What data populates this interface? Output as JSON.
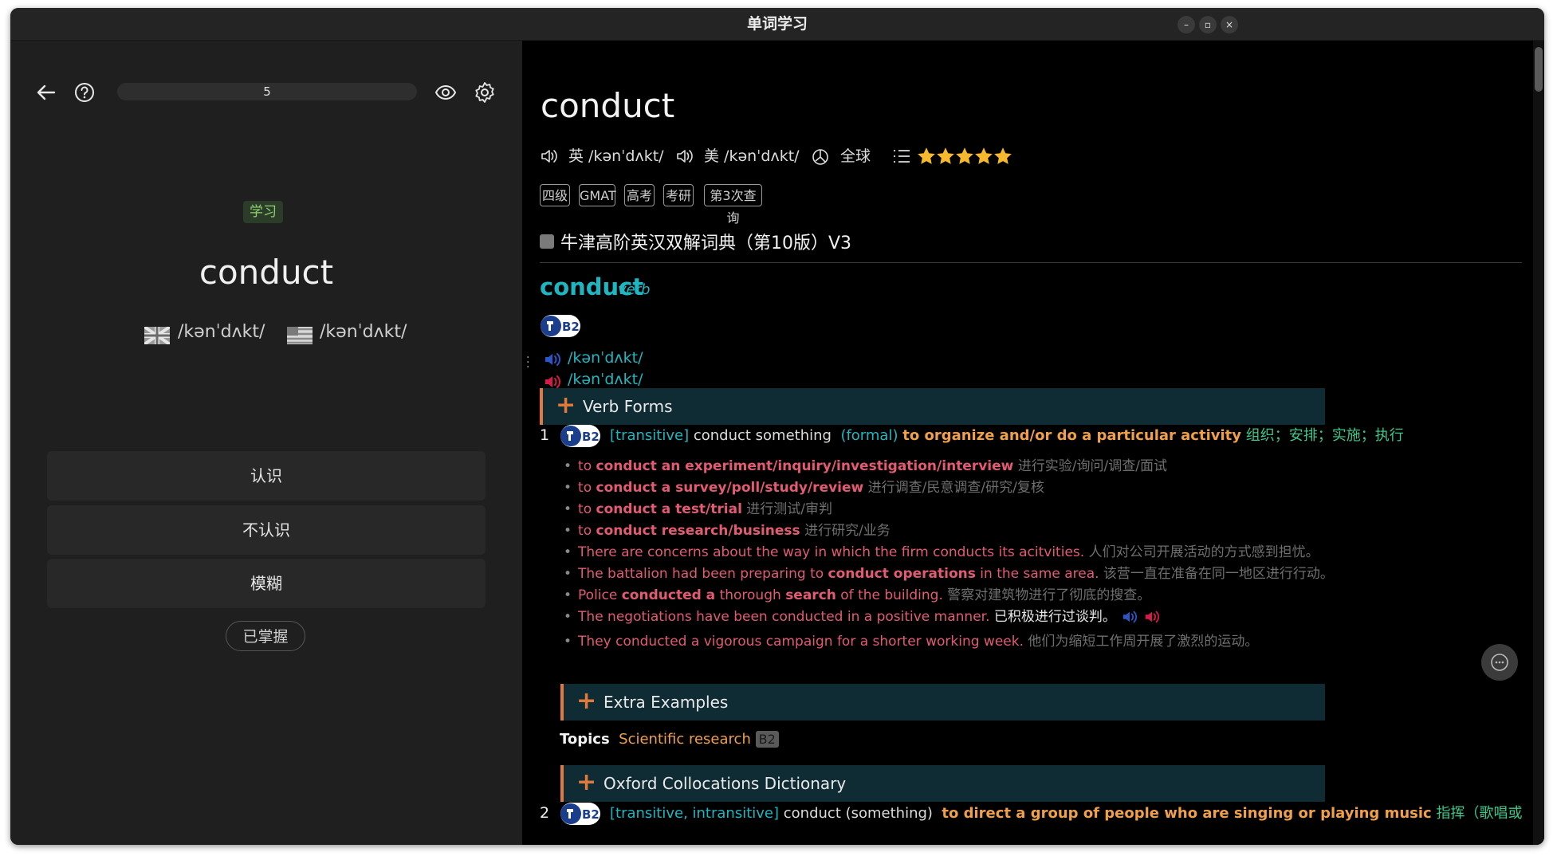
{
  "window": {
    "title": "单词学习"
  },
  "left": {
    "progress_value": "5",
    "mode_tag": "学习",
    "word": "conduct",
    "phonetic_uk": "/kənˈdʌkt/",
    "phonetic_us": "/kənˈdʌkt/",
    "buttons": {
      "know": "认识",
      "dont_know": "不认识",
      "vague": "模糊",
      "mastered": "已掌握"
    }
  },
  "right": {
    "headword": "conduct",
    "uk_label": "英 /kənˈdʌkt/",
    "us_label": "美 /kənˈdʌkt/",
    "global_label": "全球",
    "rating_stars": 5,
    "tags": [
      "四级",
      "GMAT",
      "高考",
      "考研",
      "第3次查询"
    ],
    "dictionary_name": "牛津高阶英汉双解词典（第10版）V3",
    "entry": {
      "word": "conduct",
      "pos": "verb",
      "level": "B2",
      "phonetic_uk": "/kənˈdʌkt/",
      "phonetic_us": "/kənˈdʌkt/",
      "verb_forms_label": "Verb Forms",
      "sense1": {
        "num": "1",
        "level": "B2",
        "grammar": "[transitive]",
        "pattern": "conduct something",
        "register": "(formal)",
        "definition": "to organize and/or do a particular activity",
        "zh": "组织；安排；实施；执行",
        "examples": [
          {
            "pre": "to ",
            "bold": "conduct an experiment/inquiry/investigation/interview",
            "post": "",
            "zh": "进行实验/询问/调查/面试"
          },
          {
            "pre": "to ",
            "bold": "conduct a survey/poll/study/review",
            "post": "",
            "zh": "进行调查/民意调查/研究/复核"
          },
          {
            "pre": "to ",
            "bold": "conduct a test/trial",
            "post": "",
            "zh": "进行测试/审判"
          },
          {
            "pre": "to ",
            "bold": "conduct research/business",
            "post": "",
            "zh": "进行研究/业务"
          },
          {
            "pre": "There are concerns about the way in which the firm conducts its acitvities.",
            "bold": "",
            "post": "",
            "zh": "人们对公司开展活动的方式感到担忧。"
          },
          {
            "pre": "The battalion had been preparing to ",
            "bold": "conduct operations",
            "post": " in the same area.",
            "zh": "该营一直在准备在同一地区进行行动。"
          },
          {
            "pre": "Police ",
            "bold": "conducted a",
            "post": " thorough ",
            "bold2": "search",
            "post2": " of the building.",
            "zh": "警察对建筑物进行了彻底的搜查。"
          },
          {
            "pre": "The negotiations have been conducted in a positive manner.",
            "bold": "",
            "post": "",
            "zh": "已积极进行过谈判。"
          },
          {
            "pre": "They conducted a vigorous campaign for a shorter working week.",
            "bold": "",
            "post": "",
            "zh": "他们为缩短工作周开展了激烈的运动。"
          }
        ],
        "extra_examples_label": "Extra Examples",
        "topics_label": "Topics",
        "topic": "Scientific research",
        "topic_level": "B2",
        "collocations_label": "Oxford Collocations Dictionary"
      },
      "sense2": {
        "num": "2",
        "level": "B2",
        "grammar": "[transitive, intransitive]",
        "pattern": "conduct (something)",
        "definition": "to direct a group of people who are singing or playing music",
        "zh": "指挥（歌唱或"
      }
    }
  },
  "colors": {
    "teal": "#1fb6c1",
    "orange": "#f0a04b",
    "red": "#e25b73",
    "green": "#3ec78a"
  }
}
